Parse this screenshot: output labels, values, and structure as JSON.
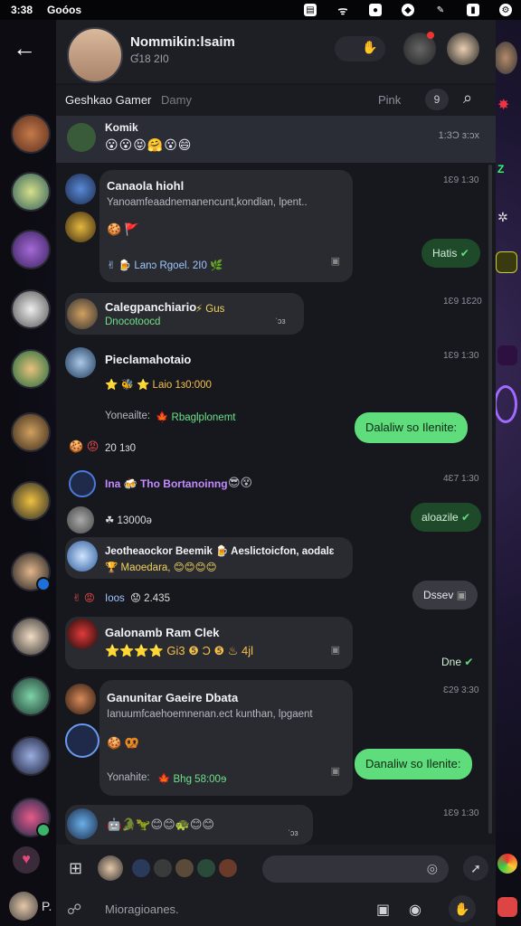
{
  "status": {
    "time": "3:38",
    "carrier": "Goóos"
  },
  "header": {
    "title": "Nommikin:lsaim",
    "subtitle": "Ɠ18 2I0",
    "mute_glyph": "✋",
    "notify_glyph": "⬤"
  },
  "tabs": {
    "active": "Geshkao Gamer",
    "secondary": "Damy",
    "right": "Pink",
    "switch_glyph": "9",
    "search_glyph": "🔍"
  },
  "pinned": {
    "name": "Komik",
    "emojis": "😮😮😝🤗😮😄",
    "time": "1:3Ɔ ɜ:ɔx"
  },
  "messages": [
    {
      "name": "Canaola hiohl",
      "text": "Yanoamfeaadnemanencunt,kondlan, lpent..",
      "time": "1Ɛ9 1:30",
      "react": "🍪 🚩",
      "foot": "✌ 🍺 Lanɔ Rgoel. 2I0 🌿"
    },
    {
      "name": "Calegpanchiario",
      "extra": "⚡ Gus",
      "sub": "Dnocotoocd",
      "time": "1Ɛ9 1Ɛ20",
      "mini": "ˈɔɜ"
    },
    {
      "name": "Pieclamahotaio",
      "line": "⭐ 🐝 ⭐  Laio 1ɜ0:000",
      "time": "1Ɛ9 1:30"
    },
    {
      "plain": "Yoneailte:",
      "plain2": "🍁 Rbaglplonemt",
      "react": "🍪 😡",
      "count": "20 1ɜ0"
    },
    {
      "name": "Ina 🍻 Tho Bortanoinnɡ",
      "emojis": "😎😵",
      "time": "4Ɛ7 1:30",
      "sub": "☘ 13000ə"
    },
    {
      "name": "Jeotheaockor Beemik 🍺 Aeslictoicfon, aodalɛ",
      "sub": "🏆 Maoedara, 😊😊😊😊",
      "time": ""
    },
    {
      "plain": "Ioos",
      "count": "😟 2.435"
    },
    {
      "name": "Galonamb Ram Clek",
      "line": "⭐⭐⭐⭐ Gi3 ❺ Ɔ ❺ ♨ 4jl",
      "time": ""
    },
    {
      "name": "Ganunitar Gaeire Dbata",
      "text": "Ianuumfcaehoemnenan.ect kunthan, lpgaent",
      "react": "🍪 🥨",
      "time": "Ɛ29 3:30",
      "foot": "Yonahite:",
      "foot2": "🍁 Bhg 58:00ɘ"
    },
    {
      "emojis": "🤖🐊🦖😊😊🐢😊😊",
      "time": "1Ɛ9 1:30",
      "mini": "ˈɔɜ"
    }
  ],
  "outgoing": [
    {
      "text": "Hatis",
      "time": ""
    },
    {
      "text": "Dalaliw so Ilenite:",
      "time": ""
    },
    {
      "text": "aloazile",
      "time": ""
    },
    {
      "text": "Dssev",
      "time": ""
    },
    {
      "text": "Dne",
      "time": ""
    },
    {
      "text": "Danaliw so Ilenite:",
      "time": ""
    }
  ],
  "composer": {
    "placeholder": "Mioragioanes."
  },
  "left_bottom": {
    "label": "P."
  },
  "colors": {
    "accent": "#5fdc7c",
    "panel": "#17181d",
    "bubble": "#2a2b31"
  },
  "icons": [
    "back-arrow-icon",
    "search-icon",
    "emoji-icon",
    "send-icon",
    "attach-icon",
    "grid-icon",
    "mic-icon"
  ]
}
